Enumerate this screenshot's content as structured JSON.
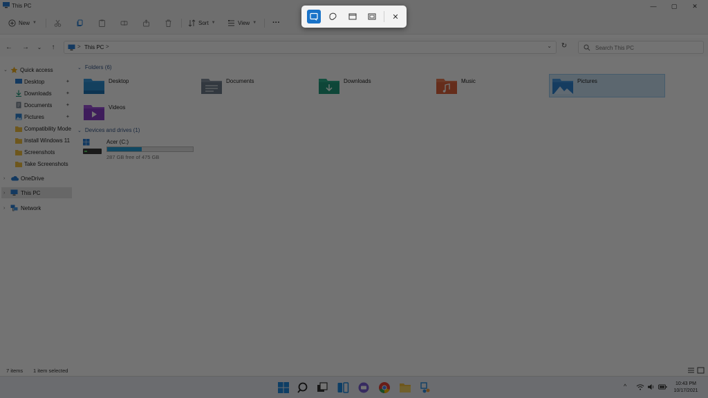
{
  "window": {
    "title": "This PC",
    "controls": {
      "minimize": "—",
      "maximize": "▢",
      "close": "✕"
    }
  },
  "toolbar": {
    "new_label": "New",
    "sort_label": "Sort",
    "view_label": "View",
    "more_label": "···",
    "icons": [
      "cut-icon",
      "copy-icon",
      "paste-icon",
      "rename-icon",
      "share-icon",
      "delete-icon"
    ]
  },
  "address": {
    "back": "←",
    "forward": "→",
    "recent": "⌄",
    "up": "↑",
    "separator": ">",
    "crumb": "This PC",
    "dropdown": "⌄",
    "refresh": "↻"
  },
  "search": {
    "placeholder": "Search This PC"
  },
  "sidebar": {
    "pin_glyph": "📌",
    "items": [
      {
        "label": "Quick access",
        "icon": "star-icon",
        "expanded": true
      },
      {
        "label": "Desktop",
        "icon": "desktop-icon",
        "pinned": true
      },
      {
        "label": "Downloads",
        "icon": "download-icon",
        "pinned": true
      },
      {
        "label": "Documents",
        "icon": "documents-icon",
        "pinned": true
      },
      {
        "label": "Pictures",
        "icon": "pictures-icon",
        "pinned": true
      },
      {
        "label": "Compatibility Mode",
        "icon": "folder-icon"
      },
      {
        "label": "Install Windows 11",
        "icon": "folder-icon"
      },
      {
        "label": "Screenshots",
        "icon": "folder-icon"
      },
      {
        "label": "Take Screenshots",
        "icon": "folder-icon"
      },
      {
        "label": "OneDrive",
        "icon": "cloud-icon"
      },
      {
        "label": "This PC",
        "icon": "computer-icon",
        "selected": true
      },
      {
        "label": "Network",
        "icon": "network-icon"
      }
    ]
  },
  "folders_section": {
    "heading": "Folders (6)",
    "items": [
      {
        "label": "Desktop",
        "color": "#2e8fd1"
      },
      {
        "label": "Documents",
        "color": "#6f7c8c"
      },
      {
        "label": "Downloads",
        "color": "#1f9b7c"
      },
      {
        "label": "Music",
        "color": "#e0643d"
      },
      {
        "label": "Pictures",
        "color": "#2f86d6",
        "selected": true
      },
      {
        "label": "Videos",
        "color": "#8a3fc9"
      }
    ]
  },
  "devices_section": {
    "heading": "Devices and drives (1)",
    "drive": {
      "name": "Acer (C:)",
      "free_text": "287 GB free of 475 GB",
      "used_fraction": 0.4
    }
  },
  "status": {
    "item_count": "7 items",
    "selection": "1 item selected"
  },
  "taskbar": {
    "apps": [
      "windows-start-icon",
      "search-icon",
      "task-view-icon",
      "widgets-icon",
      "teams-chat-icon",
      "chrome-icon",
      "file-explorer-icon",
      "snipping-tool-icon"
    ],
    "tray": {
      "chevron": "^"
    },
    "time": "10:43 PM",
    "date": "10/17/2021"
  },
  "snipping_toolbar": {
    "modes": [
      "rectangular-snip-icon",
      "freeform-snip-icon",
      "window-snip-icon",
      "fullscreen-snip-icon"
    ],
    "active_mode": "rectangular-snip-icon",
    "close": "✕"
  },
  "colors": {
    "accent": "#1a73c8",
    "drive_bar": "#26a0da",
    "selection": "#cce4f7",
    "overlay": "rgba(0,0,0,0.55)"
  }
}
